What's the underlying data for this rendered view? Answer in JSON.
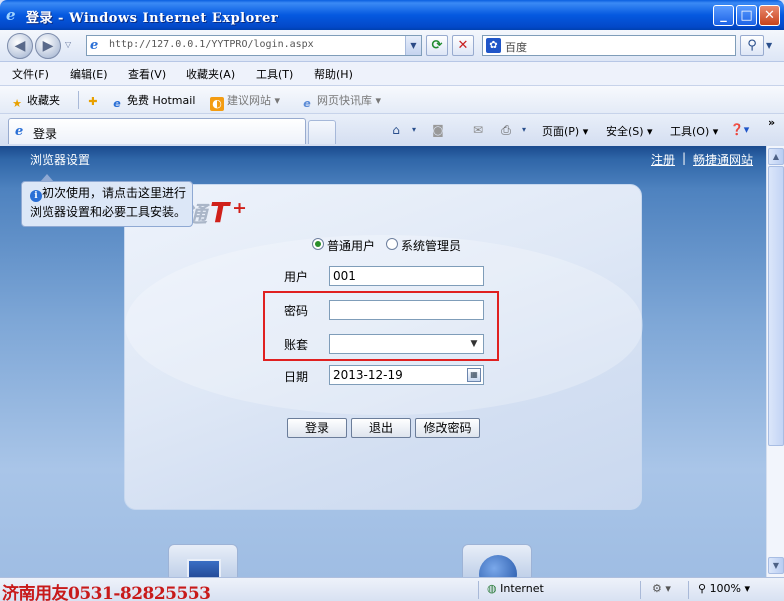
{
  "window": {
    "title": "登录 - Windows Internet Explorer",
    "min": "_",
    "max": "□",
    "close": "✕"
  },
  "address": {
    "url": "http://127.0.0.1/YYTPRO/login.aspx",
    "refresh": "⟳",
    "stop": "✕"
  },
  "search": {
    "placeholder": "百度",
    "go": "⚲"
  },
  "menu": [
    "文件(F)",
    "编辑(E)",
    "查看(V)",
    "收藏夹(A)",
    "工具(T)",
    "帮助(H)"
  ],
  "favorites": {
    "label": "收藏夹",
    "items": [
      "免费 Hotmail",
      "建议网站 ▾",
      "网页快讯库 ▾"
    ]
  },
  "tab": {
    "label": "登录"
  },
  "commands": {
    "page": "页面(P) ▾",
    "safety": "安全(S) ▾",
    "tools": "工具(O) ▾",
    "help": "❓▾"
  },
  "page": {
    "browser_settings": "浏览器设置",
    "register": "注册",
    "site": "畅捷通网站",
    "tip_line1": "初次使用，请点击这里进行",
    "tip_line2": "浏览器设置和必要工具安装。",
    "logo_cn": "畅捷通",
    "logo_t": "T⁺",
    "radio_user": "普通用户",
    "radio_admin": "系统管理员",
    "user_label": "用户",
    "user_value": "001",
    "password_label": "密码",
    "password_value": "",
    "account_label": "账套",
    "account_value": "",
    "date_label": "日期",
    "date_value": "2013-12-19",
    "login_btn": "登录",
    "exit_btn": "退出",
    "change_pw_btn": "修改密码"
  },
  "status": {
    "watermark": "济南用友0531-82825553",
    "zone": "Internet",
    "zoom": "100%"
  }
}
